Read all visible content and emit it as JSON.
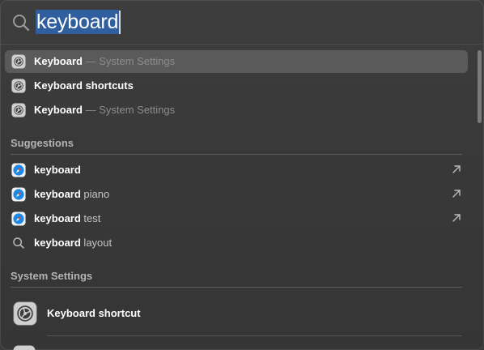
{
  "search": {
    "query": "keyboard"
  },
  "top_results": [
    {
      "title": "Keyboard",
      "subtitle": "— System Settings",
      "icon": "system-settings-icon",
      "selected": true
    },
    {
      "title": "Keyboard shortcuts",
      "subtitle": "",
      "icon": "system-settings-icon",
      "selected": false
    },
    {
      "title": "Keyboard",
      "subtitle": "— System Settings",
      "icon": "system-settings-icon",
      "selected": false
    }
  ],
  "suggestions_header": "Suggestions",
  "suggestions": [
    {
      "bold": "keyboard",
      "rest": "",
      "icon": "safari-icon",
      "arrow": true
    },
    {
      "bold": "keyboard",
      "rest": " piano",
      "icon": "safari-icon",
      "arrow": true
    },
    {
      "bold": "keyboard",
      "rest": " test",
      "icon": "safari-icon",
      "arrow": true
    },
    {
      "bold": "keyboard",
      "rest": " layout",
      "icon": "search-icon",
      "arrow": false
    }
  ],
  "system_settings_header": "System Settings",
  "system_settings_item": {
    "title": "Keyboard shortcut",
    "icon": "system-settings-icon"
  },
  "colors": {
    "selection": "#5a5a5a",
    "query_highlight": "#2f5f9e",
    "safari_blue": "#1e88e5"
  }
}
